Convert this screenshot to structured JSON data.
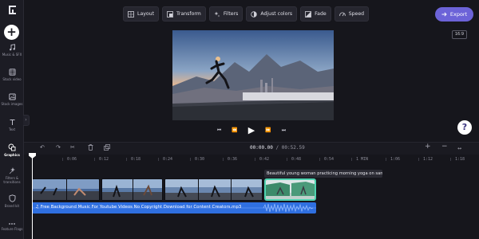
{
  "sidebar": {
    "items": [
      {
        "label": "Music & SFX",
        "icon": "music-note-icon"
      },
      {
        "label": "Stock video",
        "icon": "film-icon"
      },
      {
        "label": "Stock images",
        "icon": "image-icon"
      },
      {
        "label": "Text",
        "icon": "text-icon"
      },
      {
        "label": "Graphics",
        "icon": "shapes-icon",
        "active": true
      },
      {
        "label": "Filters & transitions",
        "icon": "filters-icon"
      },
      {
        "label": "Brand kit",
        "icon": "shield-icon"
      },
      {
        "label": "Feature Flags",
        "icon": "more-icon"
      }
    ]
  },
  "toolbar": {
    "layout": "Layout",
    "transform": "Transform",
    "filters": "Filters",
    "adjust_colors": "Adjust colors",
    "fade": "Fade",
    "speed": "Speed",
    "export": "Export"
  },
  "preview": {
    "aspect_ratio": "16:9"
  },
  "timeline": {
    "current_time": "00:00.00",
    "separator": "/",
    "duration": "00:52.59",
    "ruler_ticks": [
      "0:06",
      "0:12",
      "0:18",
      "0:24",
      "0:30",
      "0:36",
      "0:42",
      "0:48",
      "0:54",
      "1 MIN",
      "1:06",
      "1:12",
      "1:18"
    ],
    "selected_clip_title": "Beautiful young woman practicing morning yoga on san...",
    "audio_clip_title": "Free Background Music For Youtube Videos No Copyright Download for Content Creators.mp3"
  },
  "colors": {
    "accent": "#6c63d8",
    "selection": "#4fd3b0",
    "audio": "#2f6fe0"
  }
}
